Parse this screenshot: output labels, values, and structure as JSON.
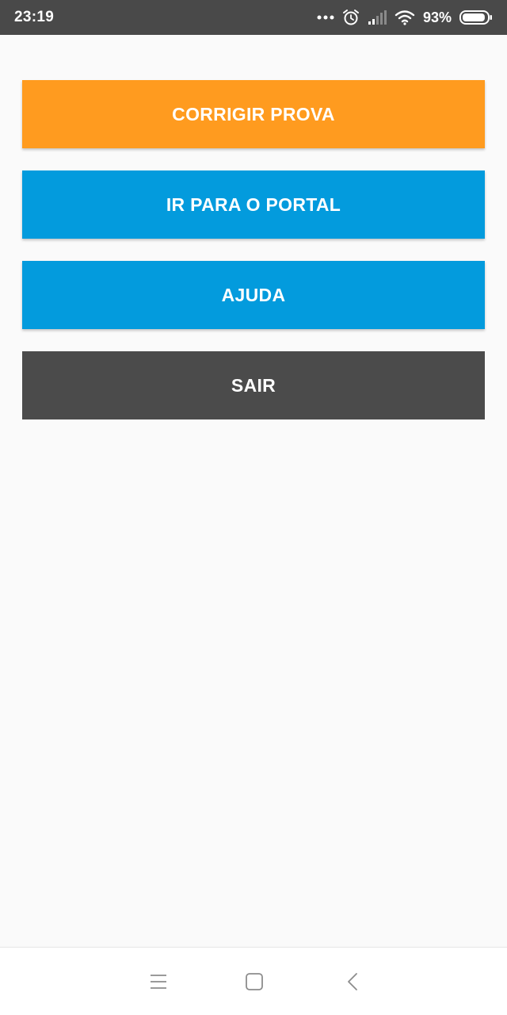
{
  "status_bar": {
    "time": "23:19",
    "battery_percent": "93%",
    "icons": [
      "more-dots-icon",
      "alarm-icon",
      "signal-icon",
      "wifi-icon",
      "battery-icon"
    ],
    "battery_level": 0.93
  },
  "menu": {
    "corrigir_prova": "CORRIGIR PROVA",
    "ir_para_portal": "IR PARA O PORTAL",
    "ajuda": "AJUDA",
    "sair": "SAIR"
  },
  "colors": {
    "orange": "#ff9b1f",
    "blue": "#039bdd",
    "dark": "#4b4b4b",
    "status_bar": "#494949"
  },
  "nav_bar": {
    "icons": [
      "menu-icon",
      "home-icon",
      "back-icon"
    ]
  }
}
